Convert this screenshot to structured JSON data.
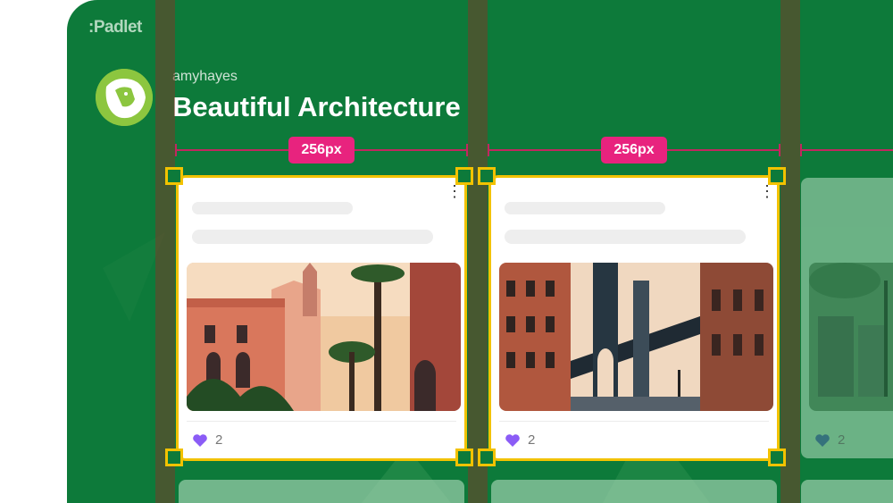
{
  "app": {
    "logo": ":Padlet"
  },
  "board": {
    "author": "amyhayes",
    "title": "Beautiful Architecture",
    "background_color": "#0d7a3a"
  },
  "annotations": {
    "width_label_1": "256px",
    "width_label_2": "256px",
    "highlight_color": "#f2c200",
    "label_color": "#e8237e"
  },
  "cards": [
    {
      "image_icon": "mediterranean-city-illustration",
      "likes": "2"
    },
    {
      "image_icon": "bridge-street-illustration",
      "likes": "2"
    },
    {
      "image_icon": "canal-town-illustration",
      "likes": "2"
    }
  ]
}
